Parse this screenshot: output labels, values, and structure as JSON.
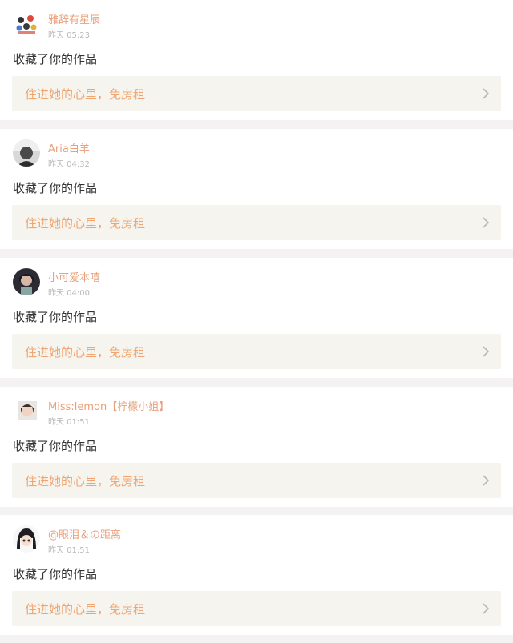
{
  "feed": {
    "items": [
      {
        "username": "雅辞有星辰",
        "time": "昨天 05:23",
        "action": "收藏了你的作品",
        "promo": "住进她的心里，免房租",
        "avatar_icon": "cartoon-group-avatar"
      },
      {
        "username": "Aria白羊",
        "time": "昨天 04:32",
        "action": "收藏了你的作品",
        "promo": "住进她的心里，免房租",
        "avatar_icon": "grayscale-photo-avatar"
      },
      {
        "username": "小可爱本嘻",
        "time": "昨天 04:00",
        "action": "收藏了你的作品",
        "promo": "住进她的心里，免房租",
        "avatar_icon": "dark-photo-avatar"
      },
      {
        "username": "Miss:lemon【柠檬小姐】",
        "time": "昨天 01:51",
        "action": "收藏了你的作品",
        "promo": "住进她的心里，免房租",
        "avatar_icon": "girl-photo-avatar"
      },
      {
        "username": "@眼泪＆の距离",
        "time": "昨天 01:51",
        "action": "收藏了你的作品",
        "promo": "住进她的心里，免房租",
        "avatar_icon": "anime-girl-avatar"
      }
    ]
  },
  "colors": {
    "username": "#e9a07a",
    "time": "#b9b9b9",
    "action": "#333333",
    "promo_text": "#f0a46f",
    "promo_bg": "#f5f4ef",
    "separator": "#f4f2f2"
  }
}
